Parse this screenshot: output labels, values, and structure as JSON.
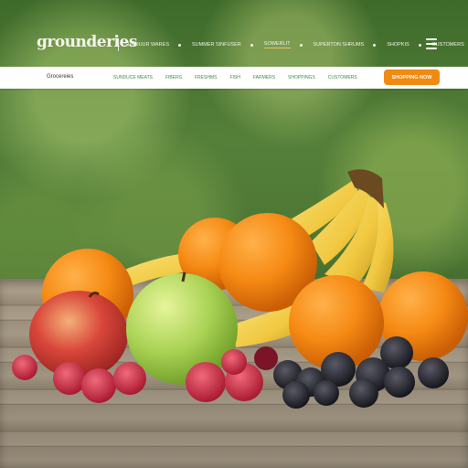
{
  "header": {
    "logo_text": "grounderies",
    "top_nav": [
      {
        "label": "SUNDUUR WARES"
      },
      {
        "label": "SUMMER SINFUSER"
      },
      {
        "label": "SOWERLIT"
      },
      {
        "label": "SUPERTON SHRUMS"
      },
      {
        "label": "SHOPKIS"
      },
      {
        "label": "CUSTOMERS"
      }
    ],
    "menu_icon": "hamburger-menu-icon"
  },
  "nav_bar": {
    "brand": "Grocereies",
    "items": [
      {
        "label": "SUNDUCE MEATS"
      },
      {
        "label": "FIBERS"
      },
      {
        "label": "FRESHMS"
      },
      {
        "label": "FISH"
      },
      {
        "label": "FARMERS"
      },
      {
        "label": "SHOPPINGS"
      },
      {
        "label": "CUSTOMERS"
      }
    ],
    "cta_label": "SHOPPING NOW"
  },
  "colors": {
    "accent": "#f08a12",
    "nav_link": "#3f8a4b",
    "active_underline": "#e8c35a"
  }
}
